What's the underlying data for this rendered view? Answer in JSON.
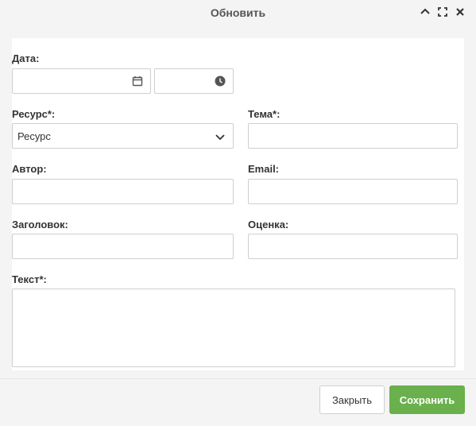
{
  "dialog": {
    "title": "Обновить"
  },
  "form": {
    "date_label": "Дата:",
    "resource_label": "Ресурс*:",
    "resource_value": "Ресурс",
    "topic_label": "Тема*:",
    "author_label": "Автор:",
    "email_label": "Email:",
    "heading_label": "Заголовок:",
    "rating_label": "Оценка:",
    "text_label": "Текст*:"
  },
  "buttons": {
    "close": "Закрыть",
    "save": "Сохранить"
  },
  "icons": {
    "collapse": "chevron-up-icon",
    "maximize": "maximize-icon",
    "close": "close-icon",
    "calendar": "calendar-icon",
    "clock": "clock-icon",
    "select": "chevron-down-icon"
  },
  "colors": {
    "save_button": "#6ab04c"
  }
}
